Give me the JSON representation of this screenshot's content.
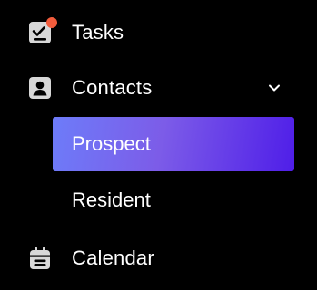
{
  "nav": {
    "tasks": {
      "label": "Tasks",
      "icon": "task-checkbox-icon",
      "has_notification": true,
      "notification_color": "#f25c3c"
    },
    "contacts": {
      "label": "Contacts",
      "icon": "contact-card-icon",
      "expanded": true,
      "chevron_icon": "chevron-down-icon",
      "children": [
        {
          "label": "Prospect",
          "active": true
        },
        {
          "label": "Resident",
          "active": false
        }
      ]
    },
    "calendar": {
      "label": "Calendar",
      "icon": "calendar-icon"
    }
  },
  "colors": {
    "background": "#000000",
    "text": "#ffffff",
    "icon": "#d7d7d7",
    "active_gradient_start": "#6d7cf9",
    "active_gradient_end": "#4f1ee8"
  }
}
